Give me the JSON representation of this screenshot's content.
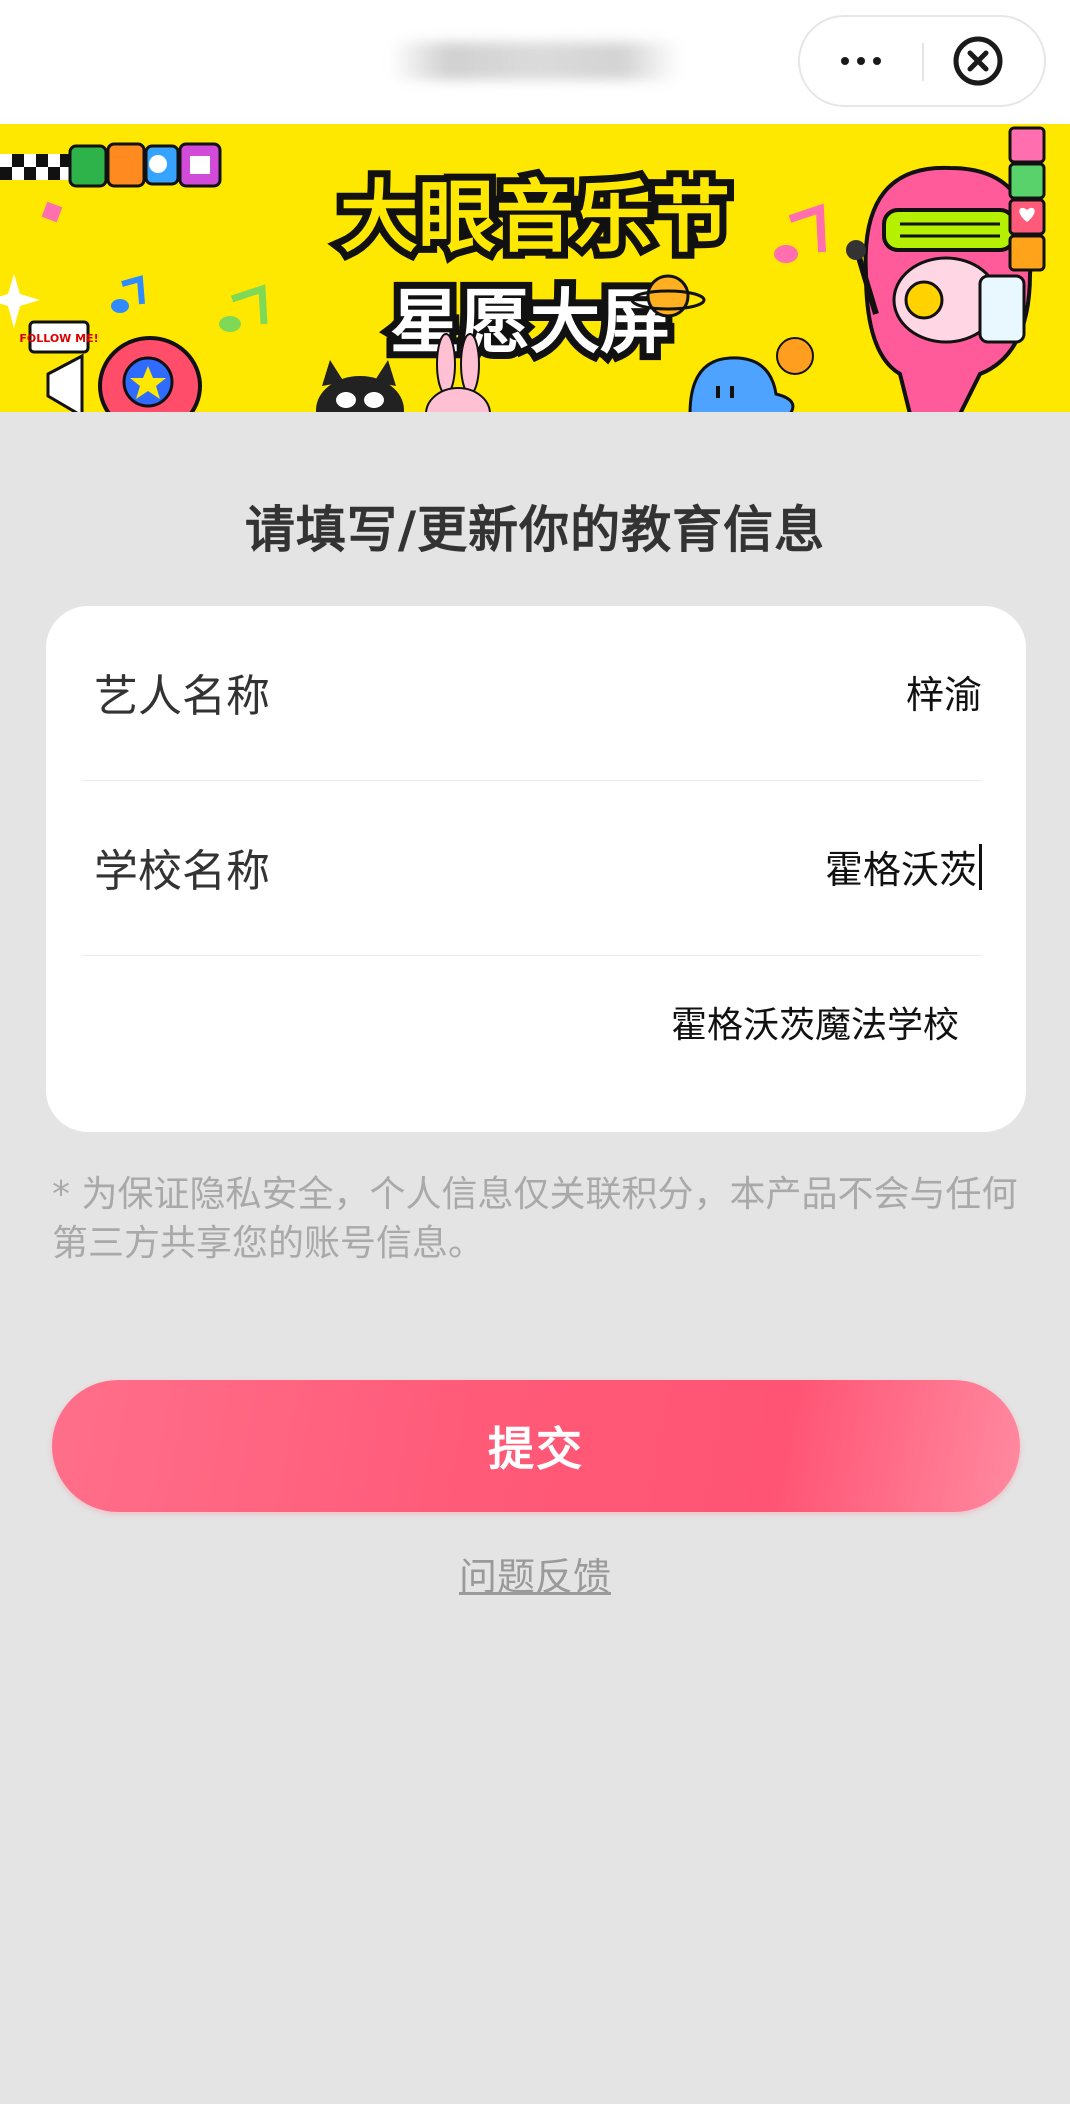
{
  "capsule": {
    "more_icon": "more-dots-icon",
    "close_icon": "close-circle-icon"
  },
  "banner": {
    "title_line1": "大眼音乐节",
    "title_line2": "星愿大屏",
    "sign_text": "FOLLOW ME!",
    "background_color": "#ffe800"
  },
  "page_title": "请填写/更新你的教育信息",
  "form": {
    "fields": [
      {
        "label": "艺人名称",
        "value": "梓渝"
      },
      {
        "label": "学校名称",
        "value": "霍格沃茨"
      }
    ],
    "suggestion": "霍格沃茨魔法学校"
  },
  "notice": "* 为保证隐私安全，个人信息仅关联积分，本产品不会与任何第三方共享您的账号信息。",
  "submit_label": "提交",
  "feedback_label": "问题反馈",
  "colors": {
    "accent": "#ff5a78",
    "page_background": "#e4e4e4"
  }
}
